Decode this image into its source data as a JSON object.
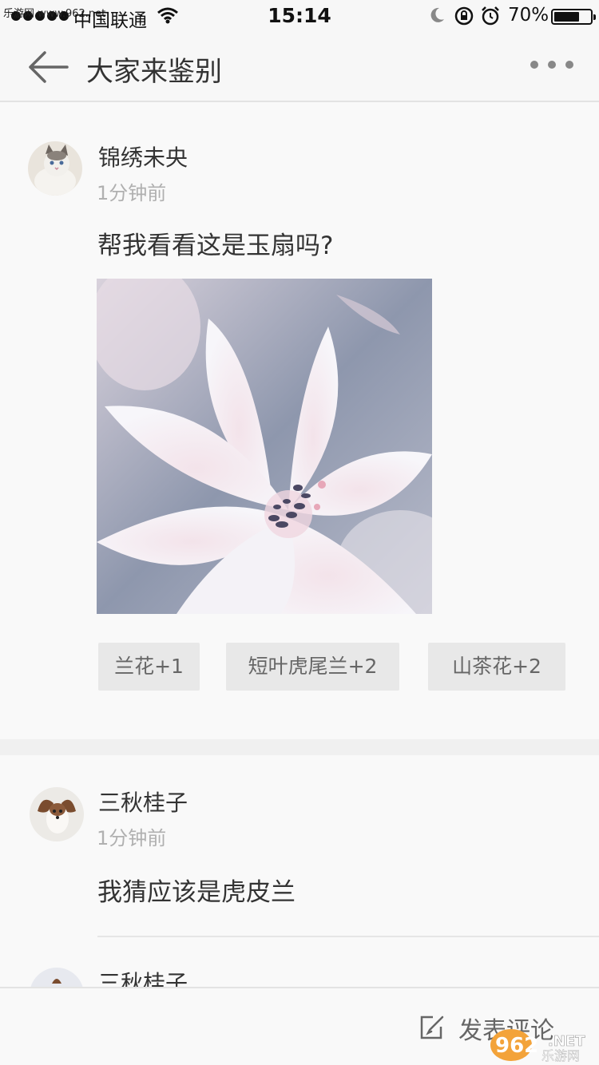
{
  "status_bar": {
    "watermark": "乐游网 www.962.net",
    "carrier": "中国联通",
    "time": "15:14",
    "battery_percent": "70%",
    "battery_level": 0.7
  },
  "nav": {
    "title": "大家来鉴别"
  },
  "post": {
    "author": "锦绣未央",
    "time": "1分钟前",
    "text": "帮我看看这是玉扇吗?",
    "tags": [
      "兰花+1",
      "短叶虎尾兰+2",
      "山茶花+2"
    ]
  },
  "comments": [
    {
      "author": "三秋桂子",
      "time": "1分钟前",
      "text": "我猜应该是虎皮兰"
    },
    {
      "author": "三秋桂子"
    }
  ],
  "bottom_bar": {
    "comment_label": "发表评论",
    "watermark_logo": "962",
    "watermark_sub": "乐游网",
    "watermark_net": ".NET"
  },
  "colors": {
    "background": "#f7f7f7",
    "tag_bg": "#e8e8e8",
    "secondary_text": "#b0b0b0"
  }
}
